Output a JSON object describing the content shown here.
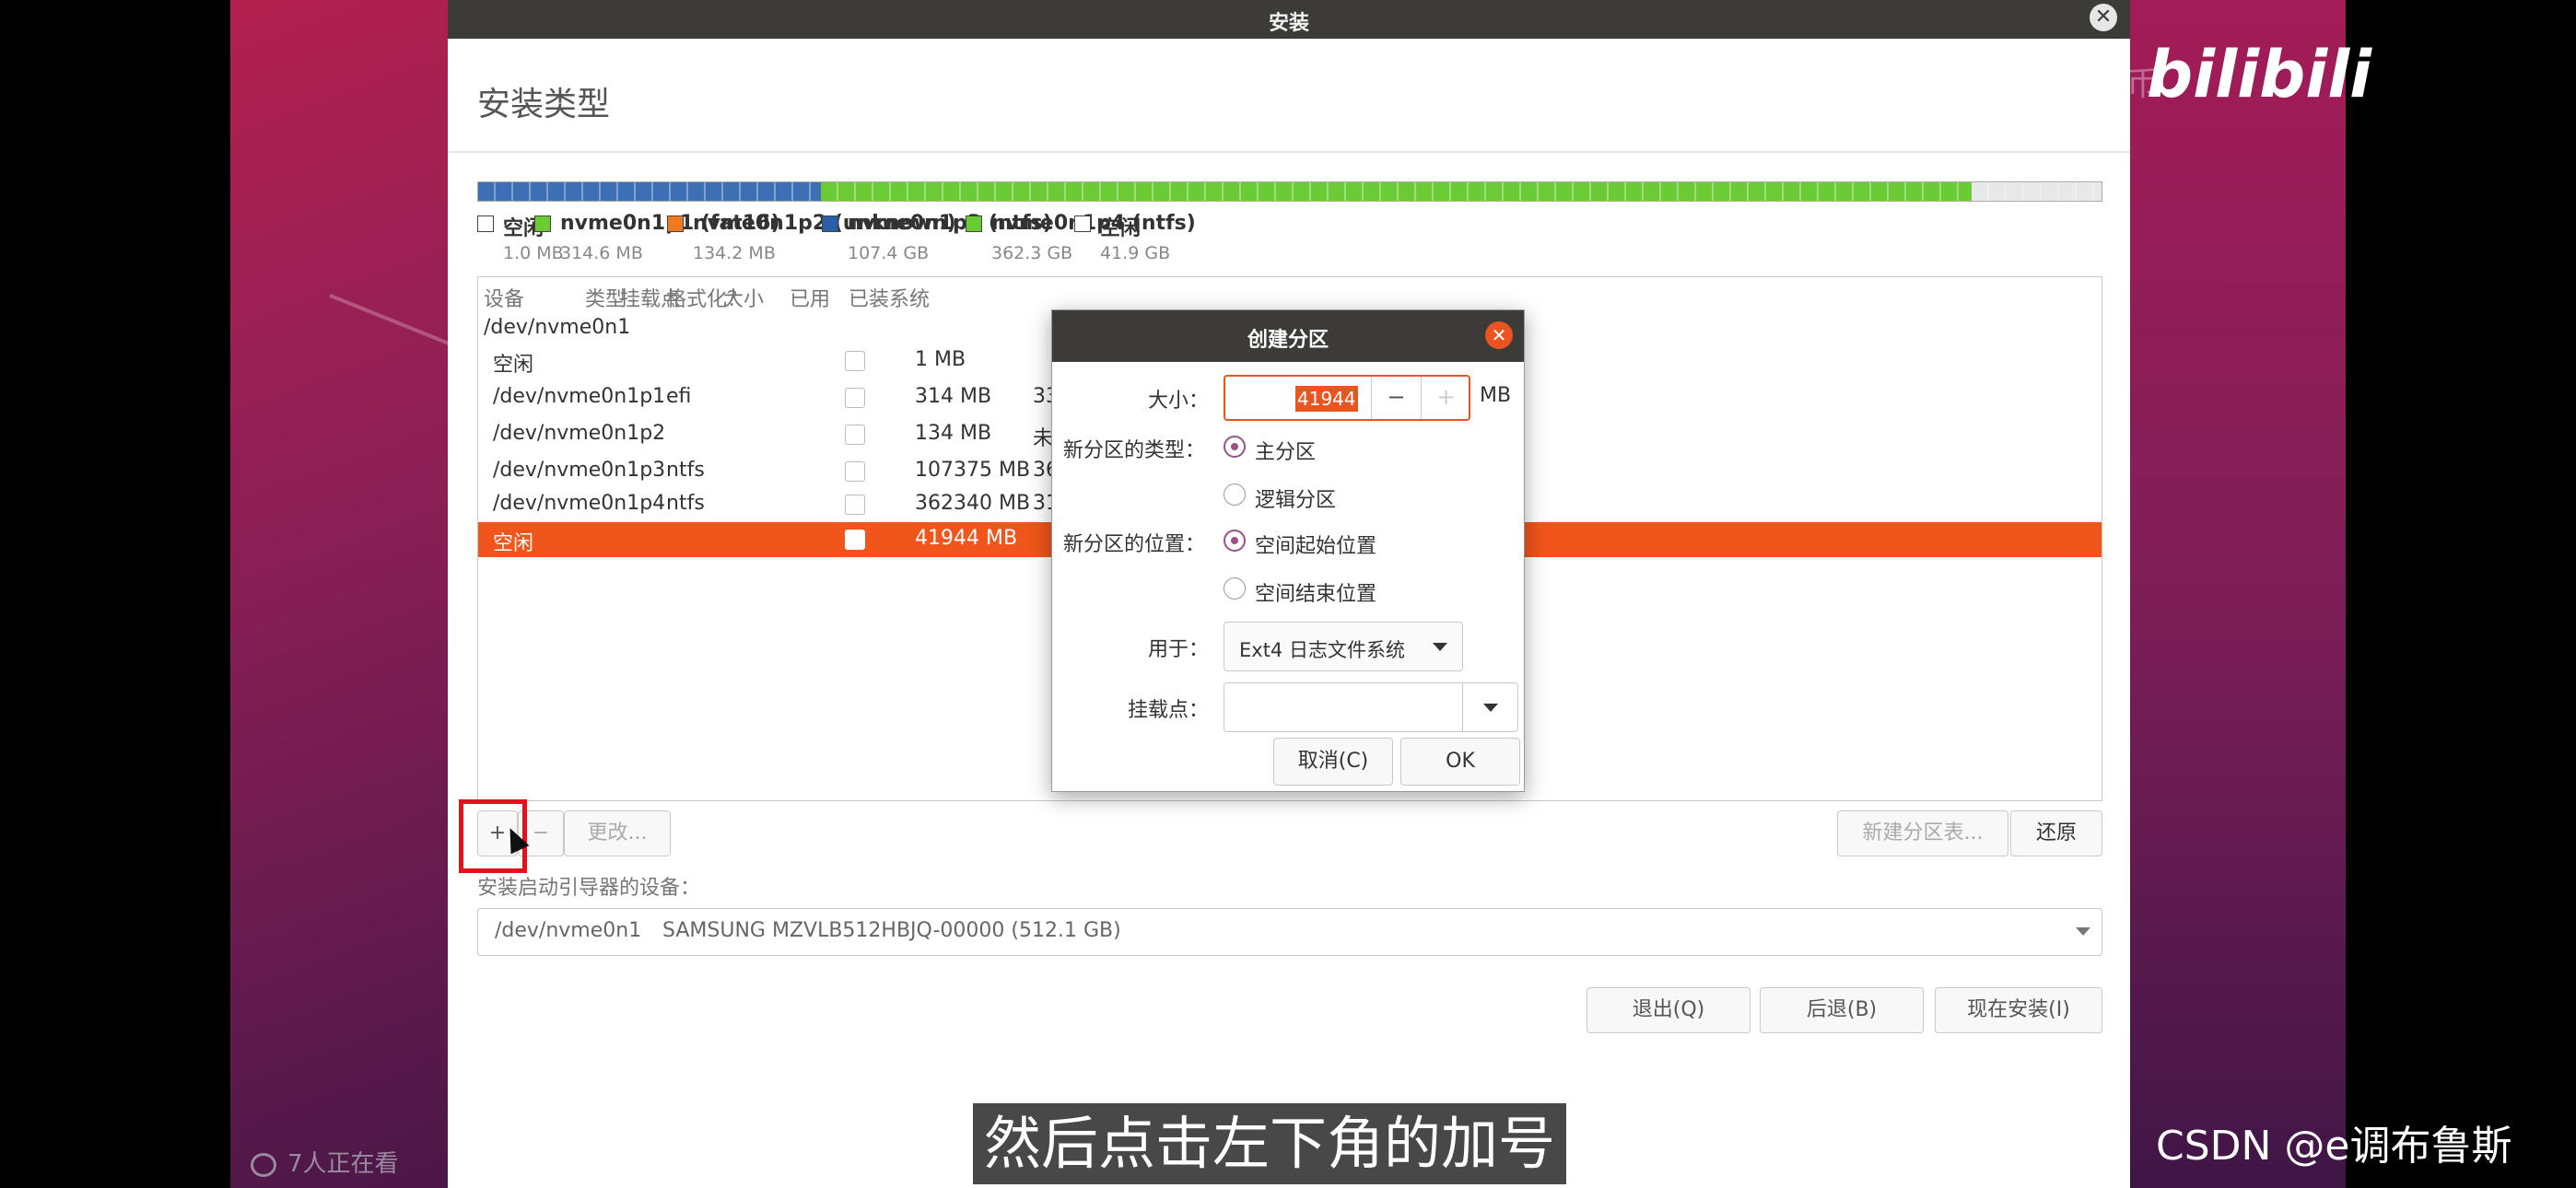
{
  "window": {
    "title": "安装",
    "close_icon": "close-icon"
  },
  "page_title": "安装类型",
  "partition_bar": [
    {
      "color": "#3d6fb5",
      "fraction": 0.211
    },
    {
      "color": "#6acb35",
      "fraction": 0.709
    },
    {
      "color": "#e8e8e8",
      "fraction": 0.08
    }
  ],
  "legend": [
    {
      "name": "空闲",
      "size": "1.0 MB",
      "color": "#ffffff"
    },
    {
      "name": "nvme0n1p1 (fat16)",
      "size": "314.6 MB",
      "color": "#6acb35"
    },
    {
      "name": "nvme0n1p2 (unknown)",
      "size": "134.2 MB",
      "color": "#f07a1f"
    },
    {
      "name": "nvme0n1p3 (ntfs)",
      "size": "107.4 GB",
      "color": "#2a5ea8"
    },
    {
      "name": "nvme0n1p4 (ntfs)",
      "size": "362.3 GB",
      "color": "#6acb35"
    },
    {
      "name": "空闲",
      "size": "41.9 GB",
      "color": "#ffffff"
    }
  ],
  "table": {
    "headers": [
      "设备",
      "类型",
      "挂载点",
      "格式化？",
      "大小",
      "已用",
      "已装系统"
    ],
    "disk": "/dev/nvme0n1",
    "rows": [
      {
        "device": "空闲",
        "type": "",
        "size": "1 MB",
        "used": ""
      },
      {
        "device": "/dev/nvme0n1p1",
        "type": "efi",
        "size": "314 MB",
        "used": "33"
      },
      {
        "device": "/dev/nvme0n1p2",
        "type": "",
        "size": "134 MB",
        "used": "未"
      },
      {
        "device": "/dev/nvme0n1p3",
        "type": "ntfs",
        "size": "107375 MB",
        "used": "36"
      },
      {
        "device": "/dev/nvme0n1p4",
        "type": "ntfs",
        "size": "362340 MB",
        "used": "31"
      },
      {
        "device": "空闲",
        "type": "",
        "size": "41944 MB",
        "used": "",
        "selected": true
      }
    ]
  },
  "toolbar": {
    "add_label": "+",
    "remove_label": "−",
    "change_label": "更改...",
    "new_table_label": "新建分区表...",
    "revert_label": "还原"
  },
  "bootloader": {
    "label": "安装启动引导器的设备：",
    "device": "/dev/nvme0n1",
    "model": "SAMSUNG MZVLB512HBJQ-00000 (512.1 GB)"
  },
  "nav_buttons": {
    "quit": "退出(Q)",
    "back": "后退(B)",
    "install": "现在安装(I)"
  },
  "dialog": {
    "title": "创建分区",
    "size_label": "大小：",
    "size_value": "41944",
    "size_unit": "MB",
    "minus": "−",
    "plus": "+",
    "type_label": "新分区的类型：",
    "type_primary": "主分区",
    "type_logical": "逻辑分区",
    "location_label": "新分区的位置：",
    "location_start": "空间起始位置",
    "location_end": "空间结束位置",
    "use_label": "用于：",
    "use_value": "Ext4 日志文件系统",
    "mount_label": "挂载点：",
    "mount_value": "",
    "cancel": "取消(C)",
    "ok": "OK"
  },
  "overlay": {
    "bili_faded": "喜欢这集就点赞投币",
    "bili_logo": "bilibili",
    "viewers": "7人正在看",
    "subtitle": "然后点击左下角的加号",
    "csdn": "CSDN @e调布鲁斯"
  }
}
